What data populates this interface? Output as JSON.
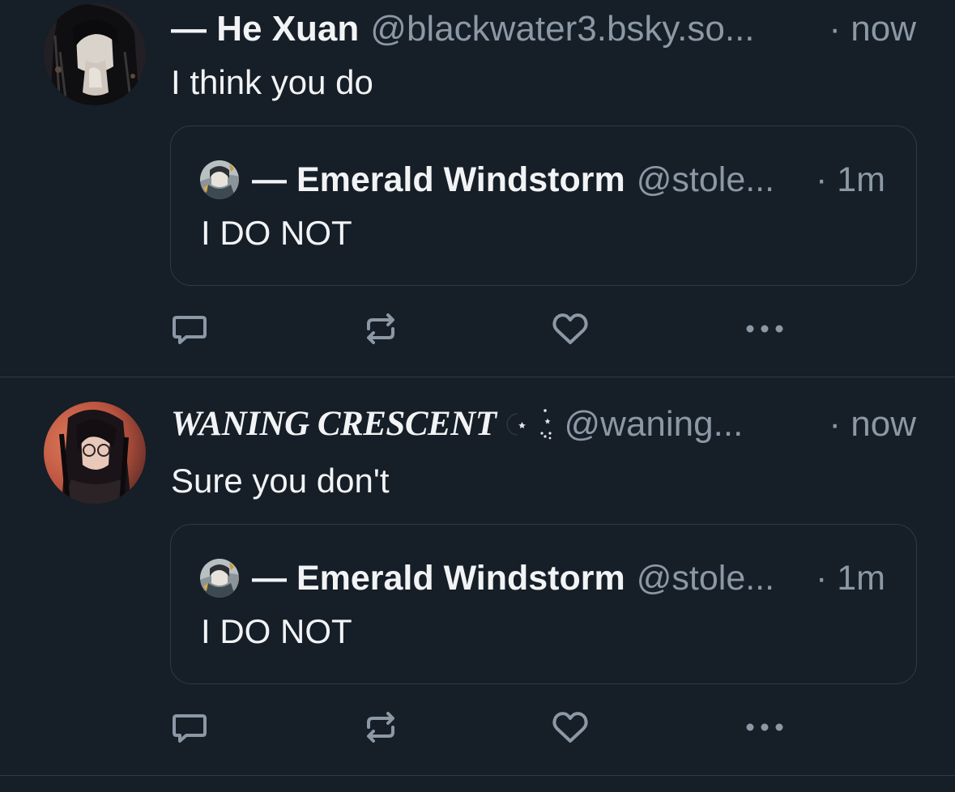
{
  "colors": {
    "background": "#161e27",
    "text_primary": "#f1f3f5",
    "text_secondary": "#8b98a5",
    "border": "#2e3a48",
    "icon": "#8b98a5"
  },
  "posts": [
    {
      "author": {
        "display_name": "— He Xuan",
        "handle": "@blackwater3.bsky.so...",
        "avatar_icon": "avatar-he-xuan"
      },
      "timestamp": "· now",
      "text": "I think you do",
      "quote": {
        "author": {
          "display_name": "— Emerald Windstorm",
          "handle": "@stole...",
          "avatar_icon": "avatar-emerald-windstorm"
        },
        "timestamp": "· 1m",
        "text": "I DO NOT"
      },
      "actions": [
        "reply-icon",
        "repost-icon",
        "like-icon",
        "more-icon"
      ]
    },
    {
      "author": {
        "display_name": "WANING CRESCENT",
        "name_decoration": "☪ ⁘",
        "handle": "@waning...",
        "avatar_icon": "avatar-waning-crescent"
      },
      "timestamp": "· now",
      "text": "Sure you don't",
      "quote": {
        "author": {
          "display_name": "— Emerald Windstorm",
          "handle": "@stole...",
          "avatar_icon": "avatar-emerald-windstorm"
        },
        "timestamp": "· 1m",
        "text": "I DO NOT"
      },
      "actions": [
        "reply-icon",
        "repost-icon",
        "like-icon",
        "more-icon"
      ]
    }
  ]
}
